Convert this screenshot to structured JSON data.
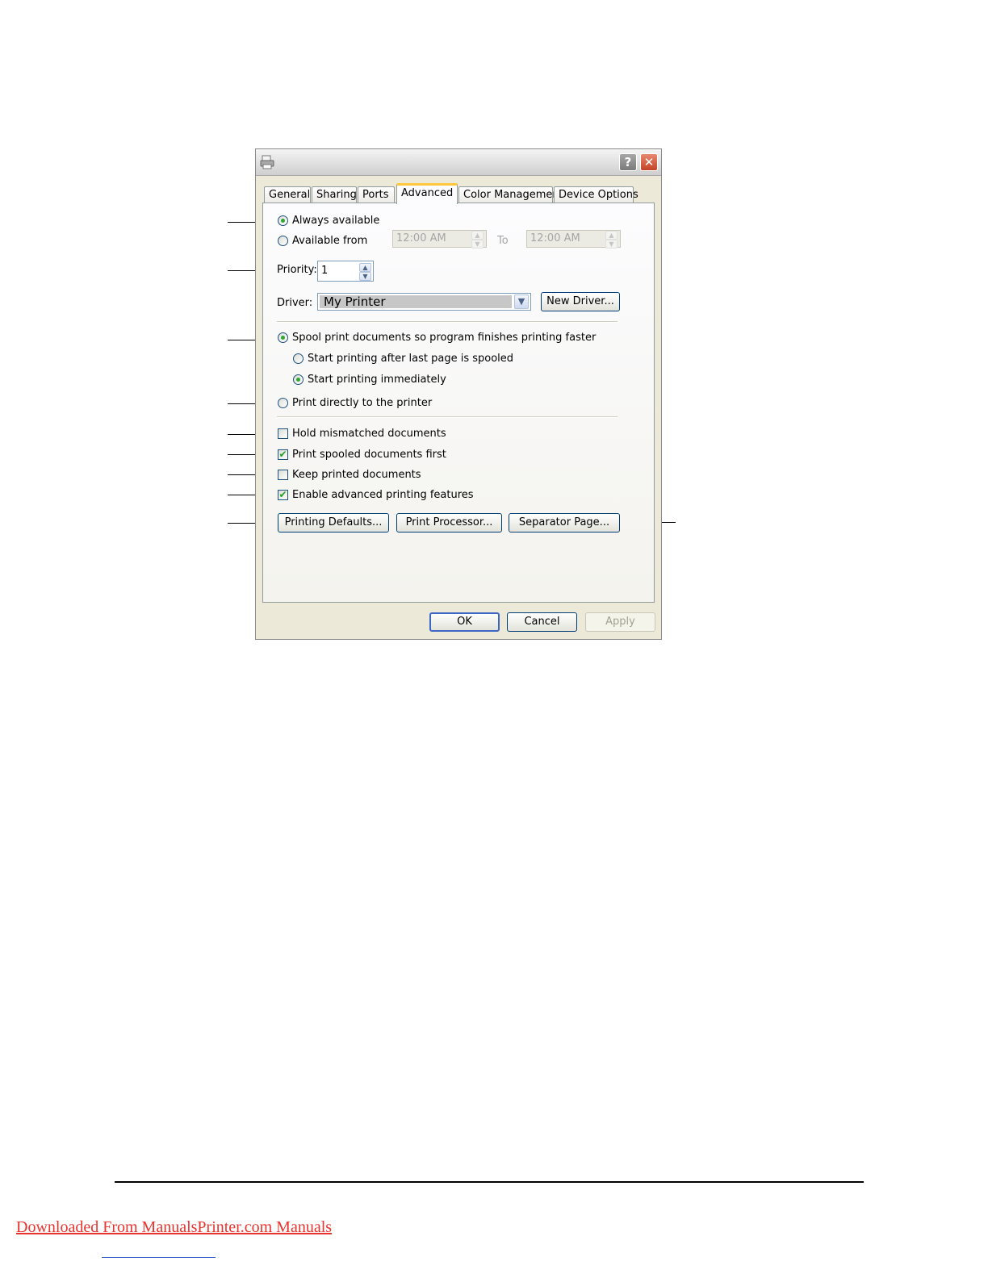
{
  "dialog": {
    "title_icon": "printer-icon",
    "help_label": "?",
    "close_label": "✕"
  },
  "tabs": [
    {
      "label": "General",
      "active": false
    },
    {
      "label": "Sharing",
      "active": false
    },
    {
      "label": "Ports",
      "active": false
    },
    {
      "label": "Advanced",
      "active": true
    },
    {
      "label": "Color Management",
      "active": false
    },
    {
      "label": "Device Options",
      "active": false
    }
  ],
  "availability": {
    "always_label": "Always available",
    "always_selected": true,
    "from_label": "Available from",
    "from_value": "12:00 AM",
    "to_label": "To",
    "to_value": "12:00 AM"
  },
  "priority": {
    "label": "Priority:",
    "value": "1"
  },
  "driver": {
    "label": "Driver:",
    "value": "My Printer",
    "new_driver_label": "New Driver..."
  },
  "spooling": {
    "spool_label": "Spool print documents so program finishes printing faster",
    "spool_selected": true,
    "after_last_page_label": "Start printing after last page is spooled",
    "after_last_page_selected": false,
    "immediately_label": "Start printing immediately",
    "immediately_selected": true,
    "direct_label": "Print directly to the printer",
    "direct_selected": false
  },
  "options": {
    "hold_mismatched_label": "Hold mismatched documents",
    "hold_mismatched_checked": false,
    "spooled_first_label": "Print spooled documents first",
    "spooled_first_checked": true,
    "keep_printed_label": "Keep printed documents",
    "keep_printed_checked": false,
    "advanced_features_label": "Enable advanced printing features",
    "advanced_features_checked": true,
    "check_mark": "✔"
  },
  "buttons": {
    "printing_defaults": "Printing Defaults...",
    "print_processor": "Print Processor...",
    "separator_page": "Separator Page...",
    "ok": "OK",
    "cancel": "Cancel",
    "apply": "Apply"
  },
  "footer": {
    "link_text": "Downloaded From ManualsPrinter.com Manuals"
  },
  "colors": {
    "dialog_bg": "#ece9d8",
    "active_tab_accent": "#ffc83c",
    "checkbox_border": "#1c5180",
    "check_green": "#21a121",
    "link_red": "#e8332e"
  }
}
